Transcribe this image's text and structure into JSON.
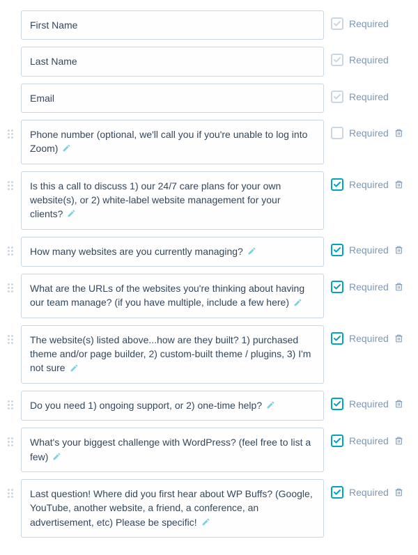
{
  "required_label": "Required",
  "fields": [
    {
      "label": "First Name",
      "editable": false,
      "required_checked": true,
      "locked": true,
      "deletable": false
    },
    {
      "label": "Last Name",
      "editable": false,
      "required_checked": true,
      "locked": true,
      "deletable": false
    },
    {
      "label": "Email",
      "editable": false,
      "required_checked": true,
      "locked": true,
      "deletable": false
    },
    {
      "label": "Phone number (optional, we'll call you if you're unable to log into Zoom)",
      "editable": true,
      "required_checked": false,
      "locked": false,
      "deletable": true
    },
    {
      "label": "Is this a call to discuss 1) our 24/7 care plans for your own website(s), or 2) white-label website management for your clients?",
      "editable": true,
      "required_checked": true,
      "locked": false,
      "deletable": true
    },
    {
      "label": "How many websites are you currently managing?",
      "editable": true,
      "required_checked": true,
      "locked": false,
      "deletable": true
    },
    {
      "label": "What are the URLs of the websites you're thinking about having our team manage? (if you have multiple, include a few here)",
      "editable": true,
      "required_checked": true,
      "locked": false,
      "deletable": true
    },
    {
      "label": "The website(s) listed above...how are they built? 1) purchased theme and/or page builder, 2) custom-built theme / plugins, 3) I'm not sure",
      "editable": true,
      "required_checked": true,
      "locked": false,
      "deletable": true
    },
    {
      "label": "Do you need 1) ongoing support, or 2) one-time help?",
      "editable": true,
      "required_checked": true,
      "locked": false,
      "deletable": true
    },
    {
      "label": "What's your biggest challenge with WordPress? (feel free to list a few)",
      "editable": true,
      "required_checked": true,
      "locked": false,
      "deletable": true
    },
    {
      "label": "Last question! Where did you first hear about WP Buffs? (Google, YouTube, another website, a friend, a conference, an advertisement, etc) Please be specific!",
      "editable": true,
      "required_checked": true,
      "locked": false,
      "deletable": true
    }
  ]
}
